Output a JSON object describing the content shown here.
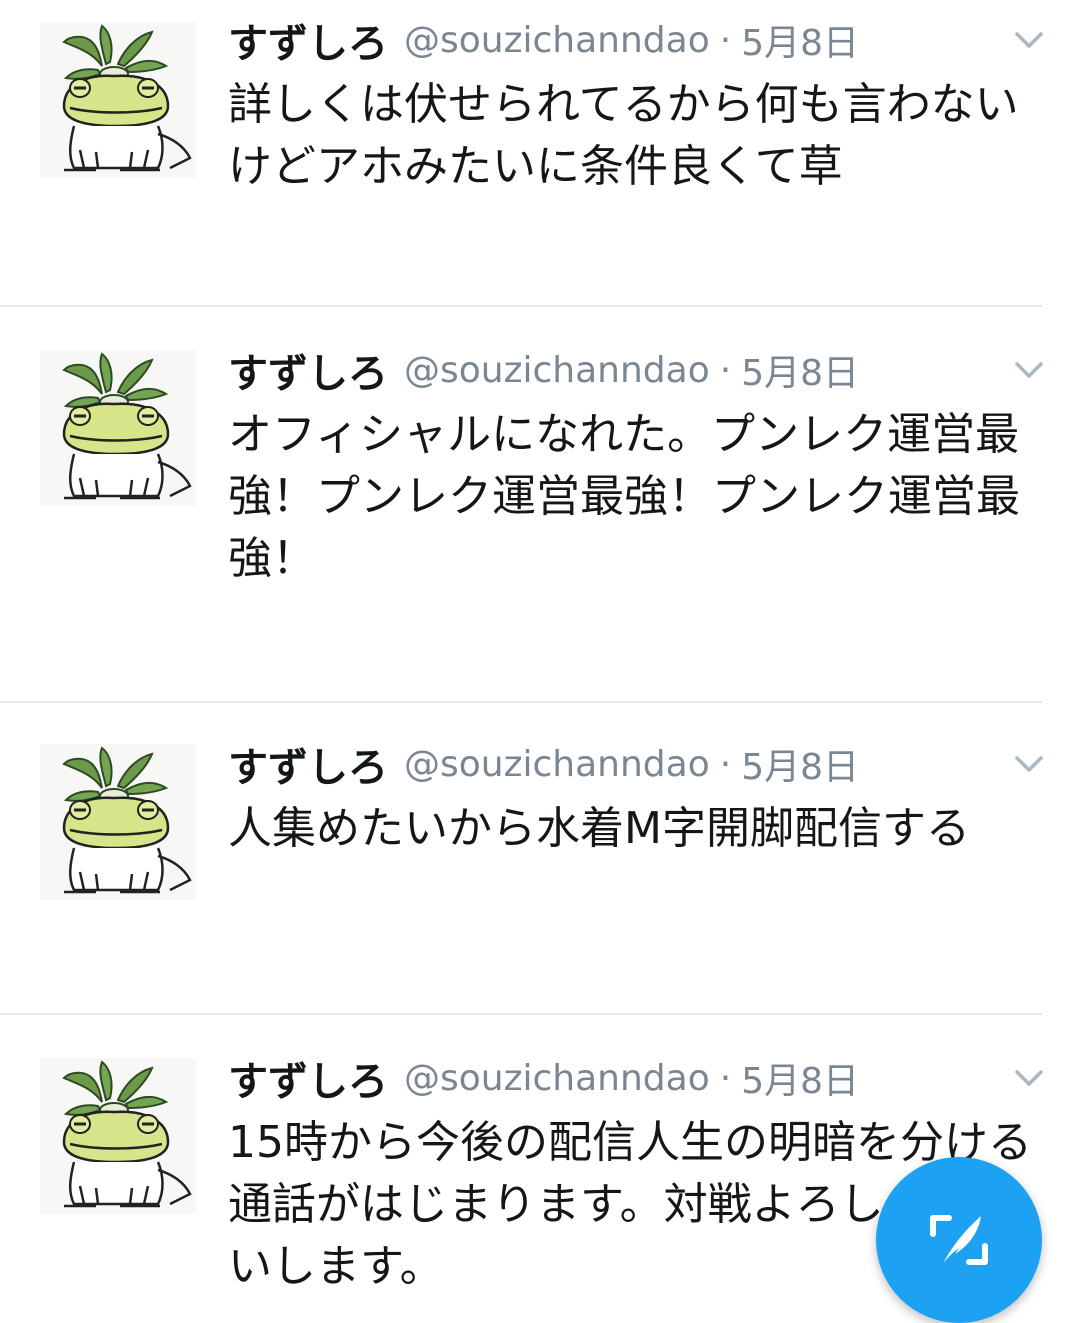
{
  "tweets": [
    {
      "name": "すずしろ",
      "handle": "@souzichanndao",
      "separator": "·",
      "date": "5月8日",
      "text": "詳しくは伏せられてるから何も言わないけどアホみたいに条件良くて草"
    },
    {
      "name": "すずしろ",
      "handle": "@souzichanndao",
      "separator": "·",
      "date": "5月8日",
      "text": "オフィシャルになれた。プンレク運営最強！プンレク運営最強！プンレク運営最強！"
    },
    {
      "name": "すずしろ",
      "handle": "@souzichanndao",
      "separator": "·",
      "date": "5月8日",
      "text": "人集めたいから水着M字開脚配信する"
    },
    {
      "name": "すずしろ",
      "handle": "@souzichanndao",
      "separator": "·",
      "date": "5月8日",
      "text": "15時から今後の配信人生の明暗を分ける通話がはじまります。対戦よろしくお願いします。"
    }
  ],
  "icons": {
    "avatar": "frog-with-leaves-avatar",
    "caret": "chevron-down-icon",
    "compose": "compose-tweet-icon"
  },
  "colors": {
    "accent": "#1da1f2",
    "secondary_text": "#7a8793",
    "divider": "#e1e8ed"
  }
}
